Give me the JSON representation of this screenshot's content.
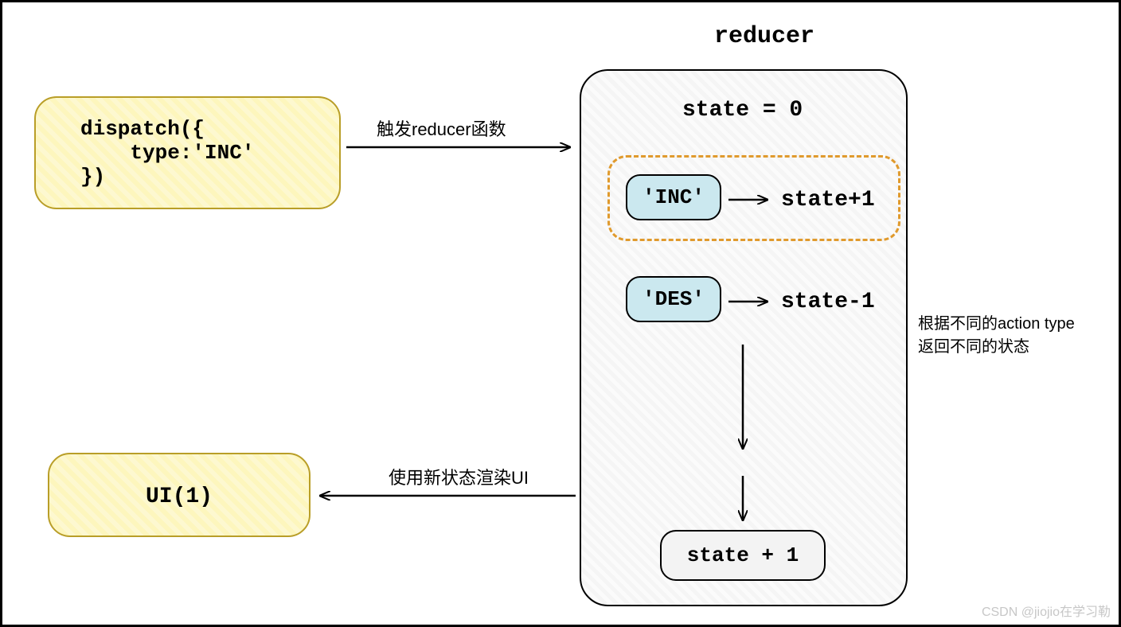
{
  "dispatch_code": "dispatch({\n    type:'INC'\n})",
  "reducer_title": "reducer",
  "state_initial": "state = 0",
  "case_inc_label": "'INC'",
  "case_inc_result": "state+1",
  "case_des_label": "'DES'",
  "case_des_result": "state-1",
  "final_state": "state + 1",
  "ui_label": "UI(1)",
  "arrow_trigger_label": "触发reducer函数",
  "arrow_render_label": "使用新状态渲染UI",
  "side_note_line1": "根据不同的action type",
  "side_note_line2": "返回不同的状态",
  "watermark": "CSDN @jiojio在学习勒"
}
